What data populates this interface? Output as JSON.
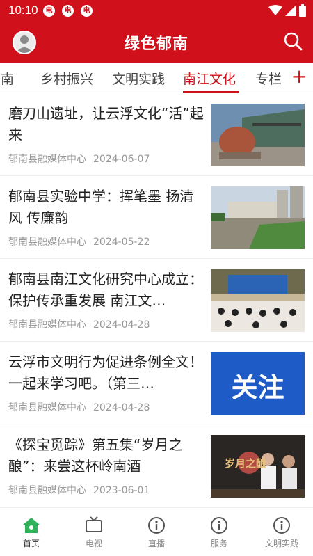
{
  "status_bar": {
    "time": "10:10",
    "notification_icons": [
      "电",
      "电",
      "电"
    ]
  },
  "header": {
    "title": "绿色郁南"
  },
  "tabs": [
    {
      "label": "郁南"
    },
    {
      "label": "乡村振兴"
    },
    {
      "label": "文明实践"
    },
    {
      "label": "南江文化",
      "active": true
    },
    {
      "label": "专栏"
    }
  ],
  "articles": [
    {
      "title": "磨刀山遗址，让云浮文化“活”起来",
      "source": "郁南县融媒体中心",
      "date": "2024-06-07",
      "thumb": "museum-photo"
    },
    {
      "title": "郁南县实验中学：挥笔墨 扬清风 传廉韵",
      "source": "郁南县融媒体中心",
      "date": "2024-05-22",
      "thumb": "school-photo"
    },
    {
      "title": "郁南县南江文化研究中心成立：保护传承重发展 南江文…",
      "source": "郁南县融媒体中心",
      "date": "2024-04-28",
      "thumb": "meeting-photo"
    },
    {
      "title": "云浮市文明行为促进条例全文！一起来学习吧。（第三…",
      "source": "郁南县融媒体中心",
      "date": "2024-04-28",
      "thumb": "follow-banner",
      "thumb_text": "关注"
    },
    {
      "title": "《探宝觅踪》第五集“岁月之酿”：来尝这杯岭南酒",
      "source": "郁南县融媒体中心",
      "date": "2023-06-01",
      "thumb": "tv-episode-poster",
      "thumb_text": "岁月之酿"
    }
  ],
  "bottom_nav": [
    {
      "label": "首页",
      "active": true
    },
    {
      "label": "电视"
    },
    {
      "label": "直播"
    },
    {
      "label": "服务"
    },
    {
      "label": "文明实践"
    }
  ],
  "colors": {
    "brand_red": "#d0111b",
    "home_green": "#2fb25a"
  }
}
